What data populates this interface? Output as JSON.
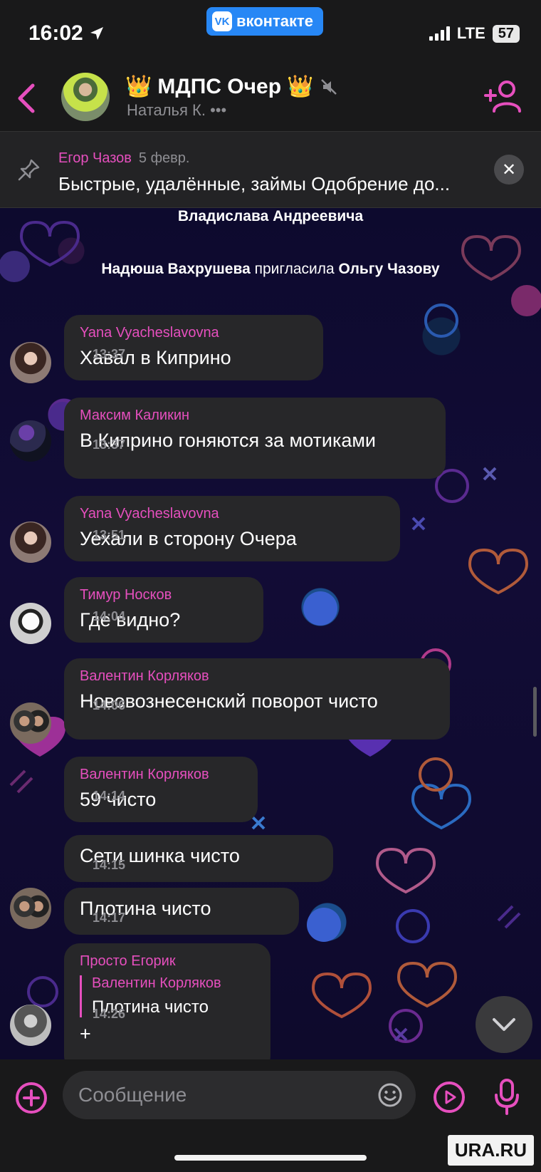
{
  "status_bar": {
    "time": "16:02",
    "app_badge": "вконтакте",
    "network": "LTE",
    "battery": "57"
  },
  "header": {
    "title": "МДПС Очер",
    "subtitle": "Наталья К. •••",
    "title_prefix_emoji": "👑",
    "title_suffix_emoji": "👑"
  },
  "pinned": {
    "author": "Егор Чазов",
    "date": "5 февр.",
    "text": "Быстрые, удалённые, займы Одобрение до..."
  },
  "system_messages": [
    {
      "text": "Владислава Андреевича"
    },
    {
      "actor": "Надюша Вахрушева",
      "verb": "пригласила",
      "target": "Ольгу Чазову"
    }
  ],
  "messages": [
    {
      "author": "Yana Vyacheslavovna",
      "text": "Хавал в Киприно",
      "time": "13:37"
    },
    {
      "author": "Максим Каликин",
      "text": "В Киприно гоняются за мотиками",
      "time": "13:37"
    },
    {
      "author": "Yana Vyacheslavovna",
      "text": "Уехали в сторону Очера",
      "time": "13:51"
    },
    {
      "author": "Тимур Носков",
      "text": "Где видно?",
      "time": "14:04"
    },
    {
      "author": "Валентин Корляков",
      "text": "Нововознесенский поворот чисто",
      "time": "14:06"
    },
    {
      "author": "Валентин Корляков",
      "text": "59 чисто",
      "time": "14:14"
    },
    {
      "author": "",
      "text": "Сети шинка чисто",
      "time": "14:15"
    },
    {
      "author": "",
      "text": "Плотина чисто",
      "time": "14:17"
    },
    {
      "author": "Просто Егорик",
      "reply_author": "Валентин Корляков",
      "reply_text": "Плотина чисто",
      "text": "+",
      "time": "14:26"
    }
  ],
  "input": {
    "placeholder": "Сообщение"
  },
  "watermark": "URA.RU",
  "colors": {
    "accent": "#e64fbe",
    "bubble": "#272729",
    "bar": "#19191a",
    "vk_blue": "#2787f5"
  }
}
